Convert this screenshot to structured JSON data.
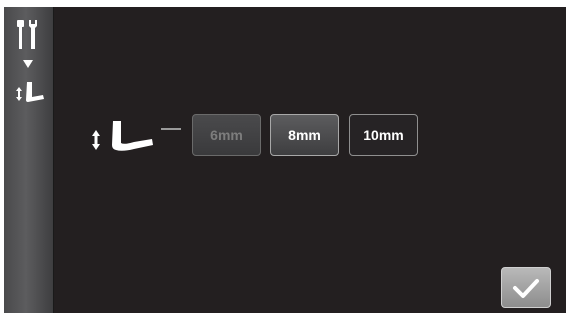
{
  "sidebar": {
    "icons": [
      "settings-tools-icon",
      "arrow-down-icon",
      "presser-foot-height-icon"
    ]
  },
  "main": {
    "icon": "presser-foot-height-icon",
    "options": [
      {
        "label": "6mm",
        "state": "disabled"
      },
      {
        "label": "8mm",
        "state": "selected"
      },
      {
        "label": "10mm",
        "state": "normal"
      }
    ]
  },
  "confirm": {
    "icon": "checkmark-icon"
  },
  "colors": {
    "background": "#231f20",
    "sidebar": "#5c5c5e",
    "button_border": "#8f8f8f",
    "confirm_button": "#a5a5a5"
  }
}
